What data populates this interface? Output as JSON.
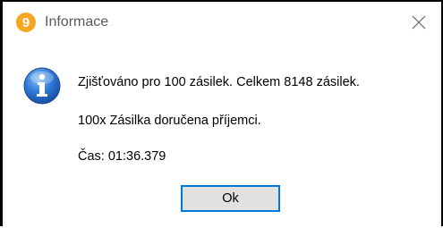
{
  "window": {
    "title": "Informace",
    "app_icon": "app-logo-icon",
    "close_icon": "close-icon",
    "accent_color": "#f5a623"
  },
  "message": {
    "icon": "info-icon",
    "line1": "Zjišťováno pro 100 zásilek. Celkem 8148 zásilek.",
    "line2": "100x Zásilka doručena příjemci.",
    "line3": "Čas: 01:36.379"
  },
  "buttons": {
    "ok_label": "Ok",
    "ok_focus_color": "#0078d7"
  }
}
